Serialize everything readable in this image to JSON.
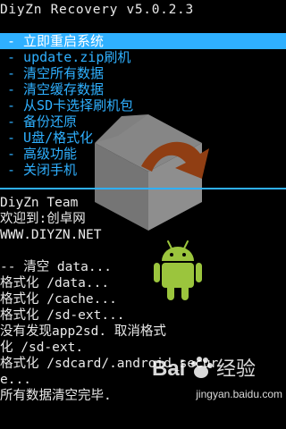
{
  "header": {
    "title": "DiyZn Recovery v5.0.2.3"
  },
  "menu": {
    "items": [
      {
        "label": "- 立即重启系统",
        "selected": true
      },
      {
        "label": "- update.zip刷机",
        "selected": false
      },
      {
        "label": "- 清空所有数据",
        "selected": false
      },
      {
        "label": "- 清空缓存数据",
        "selected": false
      },
      {
        "label": "- 从SD卡选择刷机包",
        "selected": false
      },
      {
        "label": "- 备份还原",
        "selected": false
      },
      {
        "label": "- U盘/格式化",
        "selected": false
      },
      {
        "label": "- 高级功能",
        "selected": false
      },
      {
        "label": "- 关闭手机",
        "selected": false
      }
    ]
  },
  "log": {
    "lines": [
      "DiyZn Team",
      "欢迎到:创卓网",
      "WWW.DIYZN.NET",
      "",
      "-- 清空 data...",
      "格式化 /data...",
      "格式化 /cache...",
      "格式化 /sd-ext...",
      "没有发现app2sd. 取消格式",
      "化 /sd-ext.",
      "格式化 /sdcard/.android_secur",
      "e...",
      "所有数据清空完毕."
    ]
  },
  "watermark": {
    "logo_text": "Bai",
    "logo_suffix": "经验",
    "url": "jingyan.baidu.com"
  },
  "icons": {
    "box": "recovery-box-icon",
    "robot": "android-robot-icon",
    "paw": "baidu-paw-icon"
  },
  "colors": {
    "background": "#000000",
    "accent": "#2fb0ff",
    "text": "#eaeaea",
    "selected_text": "#ffffff",
    "android_green": "#9bc53d",
    "box_arrow": "#e8651f"
  }
}
